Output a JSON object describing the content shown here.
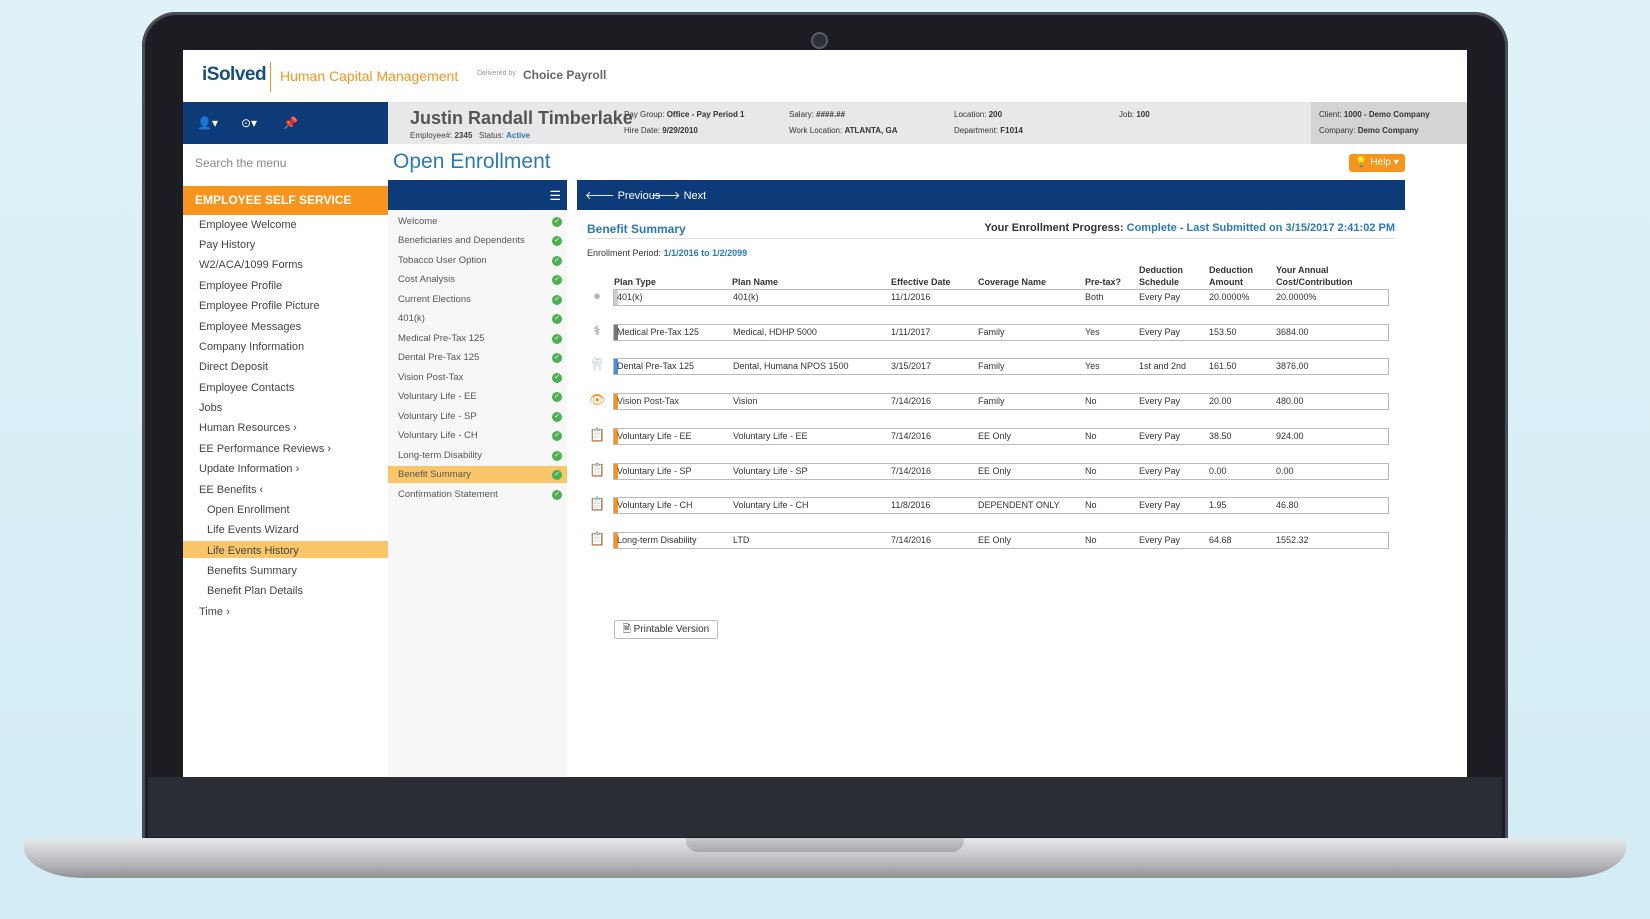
{
  "brand": {
    "logo": "iSolved",
    "subtitle": "Human Capital Management",
    "delivered_by": "Delivered by",
    "partner": "Choice Payroll"
  },
  "employee": {
    "name": "Justin Randall Timberlake",
    "employee_label": "Employee#:",
    "employee_num": "2345",
    "status_label": "Status:",
    "status": "Active",
    "pay_group_label": "Pay Group:",
    "pay_group": "Office - Pay Period 1",
    "hire_date_label": "Hire Date:",
    "hire_date": "9/29/2010",
    "salary_label": "Salary:",
    "salary": "####.##",
    "work_location_label": "Work Location:",
    "work_location": "ATLANTA, GA",
    "location_label": "Location:",
    "location": "200",
    "department_label": "Department:",
    "department": "F1014",
    "job_label": "Job:",
    "job": "100",
    "client_label": "Client:",
    "client": "1000 - Demo Company",
    "company_label": "Company:",
    "company": "Demo Company"
  },
  "sidebar": {
    "search_placeholder": "Search the menu",
    "section": "EMPLOYEE SELF SERVICE",
    "items": [
      {
        "label": "Employee Welcome"
      },
      {
        "label": "Pay History"
      },
      {
        "label": "W2/ACA/1099 Forms"
      },
      {
        "label": "Employee Profile"
      },
      {
        "label": "Employee Profile Picture"
      },
      {
        "label": "Employee Messages"
      },
      {
        "label": "Company Information"
      },
      {
        "label": "Direct Deposit"
      },
      {
        "label": "Employee Contacts"
      },
      {
        "label": "Jobs"
      },
      {
        "label": "Human Resources  ›"
      },
      {
        "label": "EE Performance Reviews  ›"
      },
      {
        "label": "Update Information  ›"
      },
      {
        "label": "EE Benefits  ‹"
      },
      {
        "label": "Open Enrollment"
      },
      {
        "label": "Life Events Wizard"
      },
      {
        "label": "Life Events History"
      },
      {
        "label": "Benefits Summary"
      },
      {
        "label": "Benefit Plan Details"
      },
      {
        "label": "Time  ›"
      }
    ]
  },
  "page": {
    "title": "Open Enrollment",
    "help": "Help"
  },
  "steps": [
    {
      "label": "Welcome"
    },
    {
      "label": "Beneficiaries and Dependents"
    },
    {
      "label": "Tobacco User Option"
    },
    {
      "label": "Cost Analysis"
    },
    {
      "label": "Current Elections"
    },
    {
      "label": "401(k)"
    },
    {
      "label": "Medical Pre-Tax 125"
    },
    {
      "label": "Dental Pre-Tax 125"
    },
    {
      "label": "Vision Post-Tax"
    },
    {
      "label": "Voluntary Life - EE"
    },
    {
      "label": "Voluntary Life - SP"
    },
    {
      "label": "Voluntary Life - CH"
    },
    {
      "label": "Long-term Disability"
    },
    {
      "label": "Benefit Summary"
    },
    {
      "label": "Confirmation Statement"
    }
  ],
  "summary": {
    "previous": "Previous",
    "next": "Next",
    "title": "Benefit Summary",
    "progress_label": "Your Enrollment Progress:",
    "progress_value": "Complete - Last Submitted on 3/15/2017 2:41:02 PM",
    "period_label": "Enrollment Period:",
    "period_value": "1/1/2016 to 1/2/2099",
    "printable": "Printable Version",
    "headers": {
      "plan_type": "Plan Type",
      "plan_name": "Plan Name",
      "effective": "Effective Date",
      "coverage": "Coverage Name",
      "pretax": "Pre-tax?",
      "schedule_1": "Deduction",
      "schedule_2": "Schedule",
      "amount_1": "Deduction",
      "amount_2": "Amount",
      "annual_1": "Your Annual",
      "annual_2": "Cost/Contribution"
    },
    "rows": [
      {
        "icon": "piggy-bank-icon",
        "plan_type": "401(k)",
        "plan_name": "401(k)",
        "effective": "11/1/2016",
        "coverage": "",
        "pretax": "Both",
        "schedule": "Every Pay",
        "amount": "20.0000%",
        "annual": "20.0000%",
        "color": "#cfcfcf"
      },
      {
        "icon": "caduceus-icon",
        "plan_type": "Medical Pre-Tax 125",
        "plan_name": "Medical, HDHP 5000",
        "effective": "1/11/2017",
        "coverage": "Family",
        "pretax": "Yes",
        "schedule": "Every Pay",
        "amount": "153.50",
        "annual": "3684.00",
        "color": "#777777"
      },
      {
        "icon": "tooth-icon",
        "plan_type": "Dental Pre-Tax 125",
        "plan_name": "Dental, Humana NPOS 1500",
        "effective": "3/15/2017",
        "coverage": "Family",
        "pretax": "Yes",
        "schedule": "1st and 2nd",
        "amount": "161.50",
        "annual": "3876.00",
        "color": "#4a90d9"
      },
      {
        "icon": "eye-icon",
        "plan_type": "Vision Post-Tax",
        "plan_name": "Vision",
        "effective": "7/14/2016",
        "coverage": "Family",
        "pretax": "No",
        "schedule": "Every Pay",
        "amount": "20.00",
        "annual": "480.00",
        "color": "#f7941d"
      },
      {
        "icon": "clipboard-icon",
        "plan_type": "Voluntary Life - EE",
        "plan_name": "Voluntary Life - EE",
        "effective": "7/14/2016",
        "coverage": "EE Only",
        "pretax": "No",
        "schedule": "Every Pay",
        "amount": "38.50",
        "annual": "924.00",
        "color": "#f7941d"
      },
      {
        "icon": "clipboard-icon",
        "plan_type": "Voluntary Life - SP",
        "plan_name": "Voluntary Life - SP",
        "effective": "7/14/2016",
        "coverage": "EE Only",
        "pretax": "No",
        "schedule": "Every Pay",
        "amount": "0.00",
        "annual": "0.00",
        "color": "#f7941d"
      },
      {
        "icon": "clipboard-icon",
        "plan_type": "Voluntary Life - CH",
        "plan_name": "Voluntary Life - CH",
        "effective": "11/8/2016",
        "coverage": "DEPENDENT ONLY",
        "pretax": "No",
        "schedule": "Every Pay",
        "amount": "1.95",
        "annual": "46.80",
        "color": "#f7941d"
      },
      {
        "icon": "clipboard-icon",
        "plan_type": "Long-term Disability",
        "plan_name": "LTD",
        "effective": "7/14/2016",
        "coverage": "EE Only",
        "pretax": "No",
        "schedule": "Every Pay",
        "amount": "64.68",
        "annual": "1552.32",
        "color": "#f7941d"
      }
    ]
  }
}
